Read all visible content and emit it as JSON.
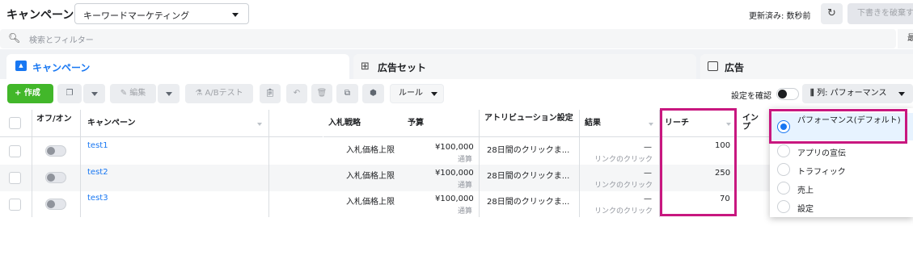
{
  "header": {
    "title": "キャンペーン",
    "campaign_select": "キーワードマーケティング",
    "updated": "更新済み: 数秒前",
    "discard": "下書きを破棄す"
  },
  "search": {
    "placeholder": "検索とフィルター",
    "right_label": "最"
  },
  "tabs": [
    {
      "label": "キャンペーン",
      "icon": "campaign-icon",
      "active": true
    },
    {
      "label": "広告セット",
      "icon": "grid-icon",
      "active": false
    },
    {
      "label": "広告",
      "icon": "ad-icon",
      "active": false
    }
  ],
  "toolbar": {
    "create": "+ 作成",
    "edit": "編集",
    "abtest": "A/Bテスト",
    "rules": "ルール",
    "confirm_settings": "設定を確認",
    "columns": "列: パフォーマンス"
  },
  "table": {
    "headers": {
      "onoff": "オフ/オン",
      "campaign": "キャンペーン",
      "bid": "入札戦略",
      "budget": "予算",
      "attribution": "アトリビューション設定",
      "results": "結果",
      "reach": "リーチ",
      "impressions": "インプ"
    },
    "rows": [
      {
        "name": "test1",
        "bid": "入札価格上限",
        "budget": "¥100,000",
        "budget_sub": "通算",
        "attribution": "28日間のクリックま...",
        "results": "—",
        "results_sub": "リンクのクリック",
        "reach": "100"
      },
      {
        "name": "test2",
        "bid": "入札価格上限",
        "budget": "¥100,000",
        "budget_sub": "通算",
        "attribution": "28日間のクリックま...",
        "results": "—",
        "results_sub": "リンクのクリック",
        "reach": "250"
      },
      {
        "name": "test3",
        "bid": "入札価格上限",
        "budget": "¥100,000",
        "budget_sub": "通算",
        "attribution": "28日間のクリックま...",
        "results": "—",
        "results_sub": "リンクのクリック",
        "reach": "70"
      }
    ]
  },
  "column_presets": [
    {
      "label": "パフォーマンス(デフォルト)",
      "selected": true
    },
    {
      "label": "アプリの宣伝",
      "selected": false
    },
    {
      "label": "トラフィック",
      "selected": false
    },
    {
      "label": "売上",
      "selected": false
    },
    {
      "label": "設定",
      "selected": false
    }
  ],
  "colors": {
    "accent": "#1877f2",
    "create": "#42b72a",
    "highlight": "#c8177f"
  }
}
